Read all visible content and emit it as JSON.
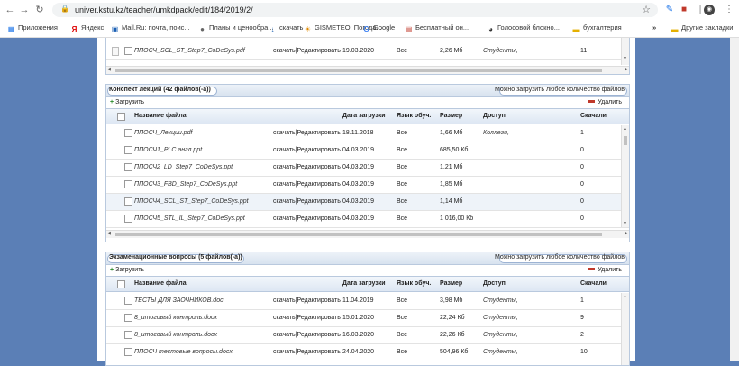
{
  "browser": {
    "url": "univer.kstu.kz/teacher/umkdpack/edit/184/2019/2/",
    "bookmarks": [
      "Приложения",
      "Яндекс",
      "Mail.Ru: почта, поис...",
      "Планы и ценообра...",
      "скачать",
      "GISMETEO: Погода...",
      "Google",
      "Бесплатный он...",
      "Голосовой блокно...",
      "бухгалтерия",
      "Другие закладки"
    ],
    "more_bookmarks": "»"
  },
  "top_row": {
    "file": "ППОСЧ_SCL_ST_Step7_CoDeSys.pdf",
    "actions": "скачать|Редактировать",
    "date": "19.03.2020",
    "lang": "Все",
    "size": "2,26 Мб",
    "access": "Студенты,",
    "downloads": "11"
  },
  "sections": [
    {
      "title": "Конспект лекций (42 файлов(-а))",
      "note": "Можно загрузить любое количество файлов",
      "upload": "Загрузить",
      "delete": "Удалить",
      "columns": [
        "Название файла",
        "Дата загрузки",
        "Язык обуч.",
        "Размер",
        "Доступ",
        "Скачали"
      ],
      "rows": [
        {
          "file": "ППОСЧ_Лекции.pdf",
          "actions": "скачать|Редактировать",
          "date": "18.11.2018",
          "lang": "Все",
          "size": "1,66 Мб",
          "access": "Коллеги,",
          "downloads": "1"
        },
        {
          "file": "ППОСЧ1_PLC англ.ppt",
          "actions": "скачать|Редактировать",
          "date": "04.03.2019",
          "lang": "Все",
          "size": "685,50 Кб",
          "access": "",
          "downloads": "0"
        },
        {
          "file": "ППОСЧ2_LD_Step7_CoDeSys.ppt",
          "actions": "скачать|Редактировать",
          "date": "04.03.2019",
          "lang": "Все",
          "size": "1,21 Мб",
          "access": "",
          "downloads": "0"
        },
        {
          "file": "ППОСЧ3_FBD_Step7_CoDeSys.ppt",
          "actions": "скачать|Редактировать",
          "date": "04.03.2019",
          "lang": "Все",
          "size": "1,85 Мб",
          "access": "",
          "downloads": "0"
        },
        {
          "file": "ППОСЧ4_SCL_ST_Step7_CoDeSys.ppt",
          "actions": "скачать|Редактировать",
          "date": "04.03.2019",
          "lang": "Все",
          "size": "1,14 Мб",
          "access": "",
          "downloads": "0"
        },
        {
          "file": "ППОСЧ5_STL_IL_Step7_CoDeSys.ppt",
          "actions": "скачать|Редактировать",
          "date": "04.03.2019",
          "lang": "Все",
          "size": "1 016,00 Кб",
          "access": "",
          "downloads": "0"
        }
      ]
    },
    {
      "title": "Экзаменационные вопросы (5 файлов(-а))",
      "note": "Можно загрузить любое количество файлов",
      "upload": "Загрузить",
      "delete": "Удалить",
      "columns": [
        "Название файла",
        "Дата загрузки",
        "Язык обуч.",
        "Размер",
        "Доступ",
        "Скачали"
      ],
      "rows": [
        {
          "file": "ТЕСТЫ ДЛЯ ЗАОЧНИКОВ.doc",
          "actions": "скачать|Редактировать",
          "date": "11.04.2019",
          "lang": "Все",
          "size": "3,98 Мб",
          "access": "Студенты,",
          "downloads": "1"
        },
        {
          "file": "8_итоговый контроль.docx",
          "actions": "скачать|Редактировать",
          "date": "15.01.2020",
          "lang": "Все",
          "size": "22,24 Кб",
          "access": "Студенты,",
          "downloads": "9"
        },
        {
          "file": "8_итоговый контроль.docx",
          "actions": "скачать|Редактировать",
          "date": "16.03.2020",
          "lang": "Все",
          "size": "22,26 Кб",
          "access": "Студенты,",
          "downloads": "2"
        },
        {
          "file": "ППОСЧ тестовые вопросы.docx",
          "actions": "скачать|Редактировать",
          "date": "24.04.2020",
          "lang": "Все",
          "size": "504,96 Кб",
          "access": "Студенты,",
          "downloads": "10"
        }
      ]
    }
  ]
}
